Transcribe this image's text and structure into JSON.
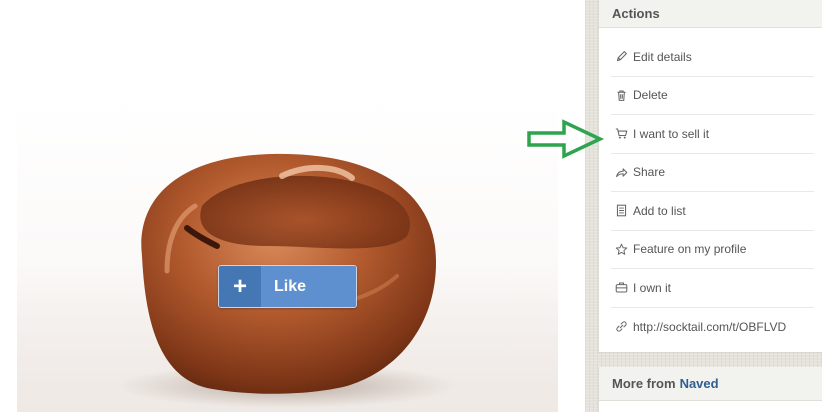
{
  "like_button": {
    "plus": "+",
    "label": "Like"
  },
  "actions_panel": {
    "title": "Actions",
    "items": [
      {
        "label": "Edit details",
        "icon": "pencil-icon"
      },
      {
        "label": "Delete",
        "icon": "trash-icon"
      },
      {
        "label": "I want to sell it",
        "icon": "cart-icon"
      },
      {
        "label": "Share",
        "icon": "share-icon"
      },
      {
        "label": "Add to list",
        "icon": "list-icon"
      },
      {
        "label": "Feature on my profile",
        "icon": "star-icon"
      },
      {
        "label": "I own it",
        "icon": "briefcase-icon"
      },
      {
        "label": "http://socktail.com/t/OBFLVD",
        "icon": "link-icon"
      }
    ]
  },
  "more_panel": {
    "title_prefix": "More from",
    "owner": "Naved"
  },
  "colors": {
    "like_dark": "#4577b5",
    "like_light": "#5e8fcf",
    "annotation_arrow": "#2ea44f",
    "owner_link": "#2d5f93",
    "chair": "#b25a2e"
  }
}
